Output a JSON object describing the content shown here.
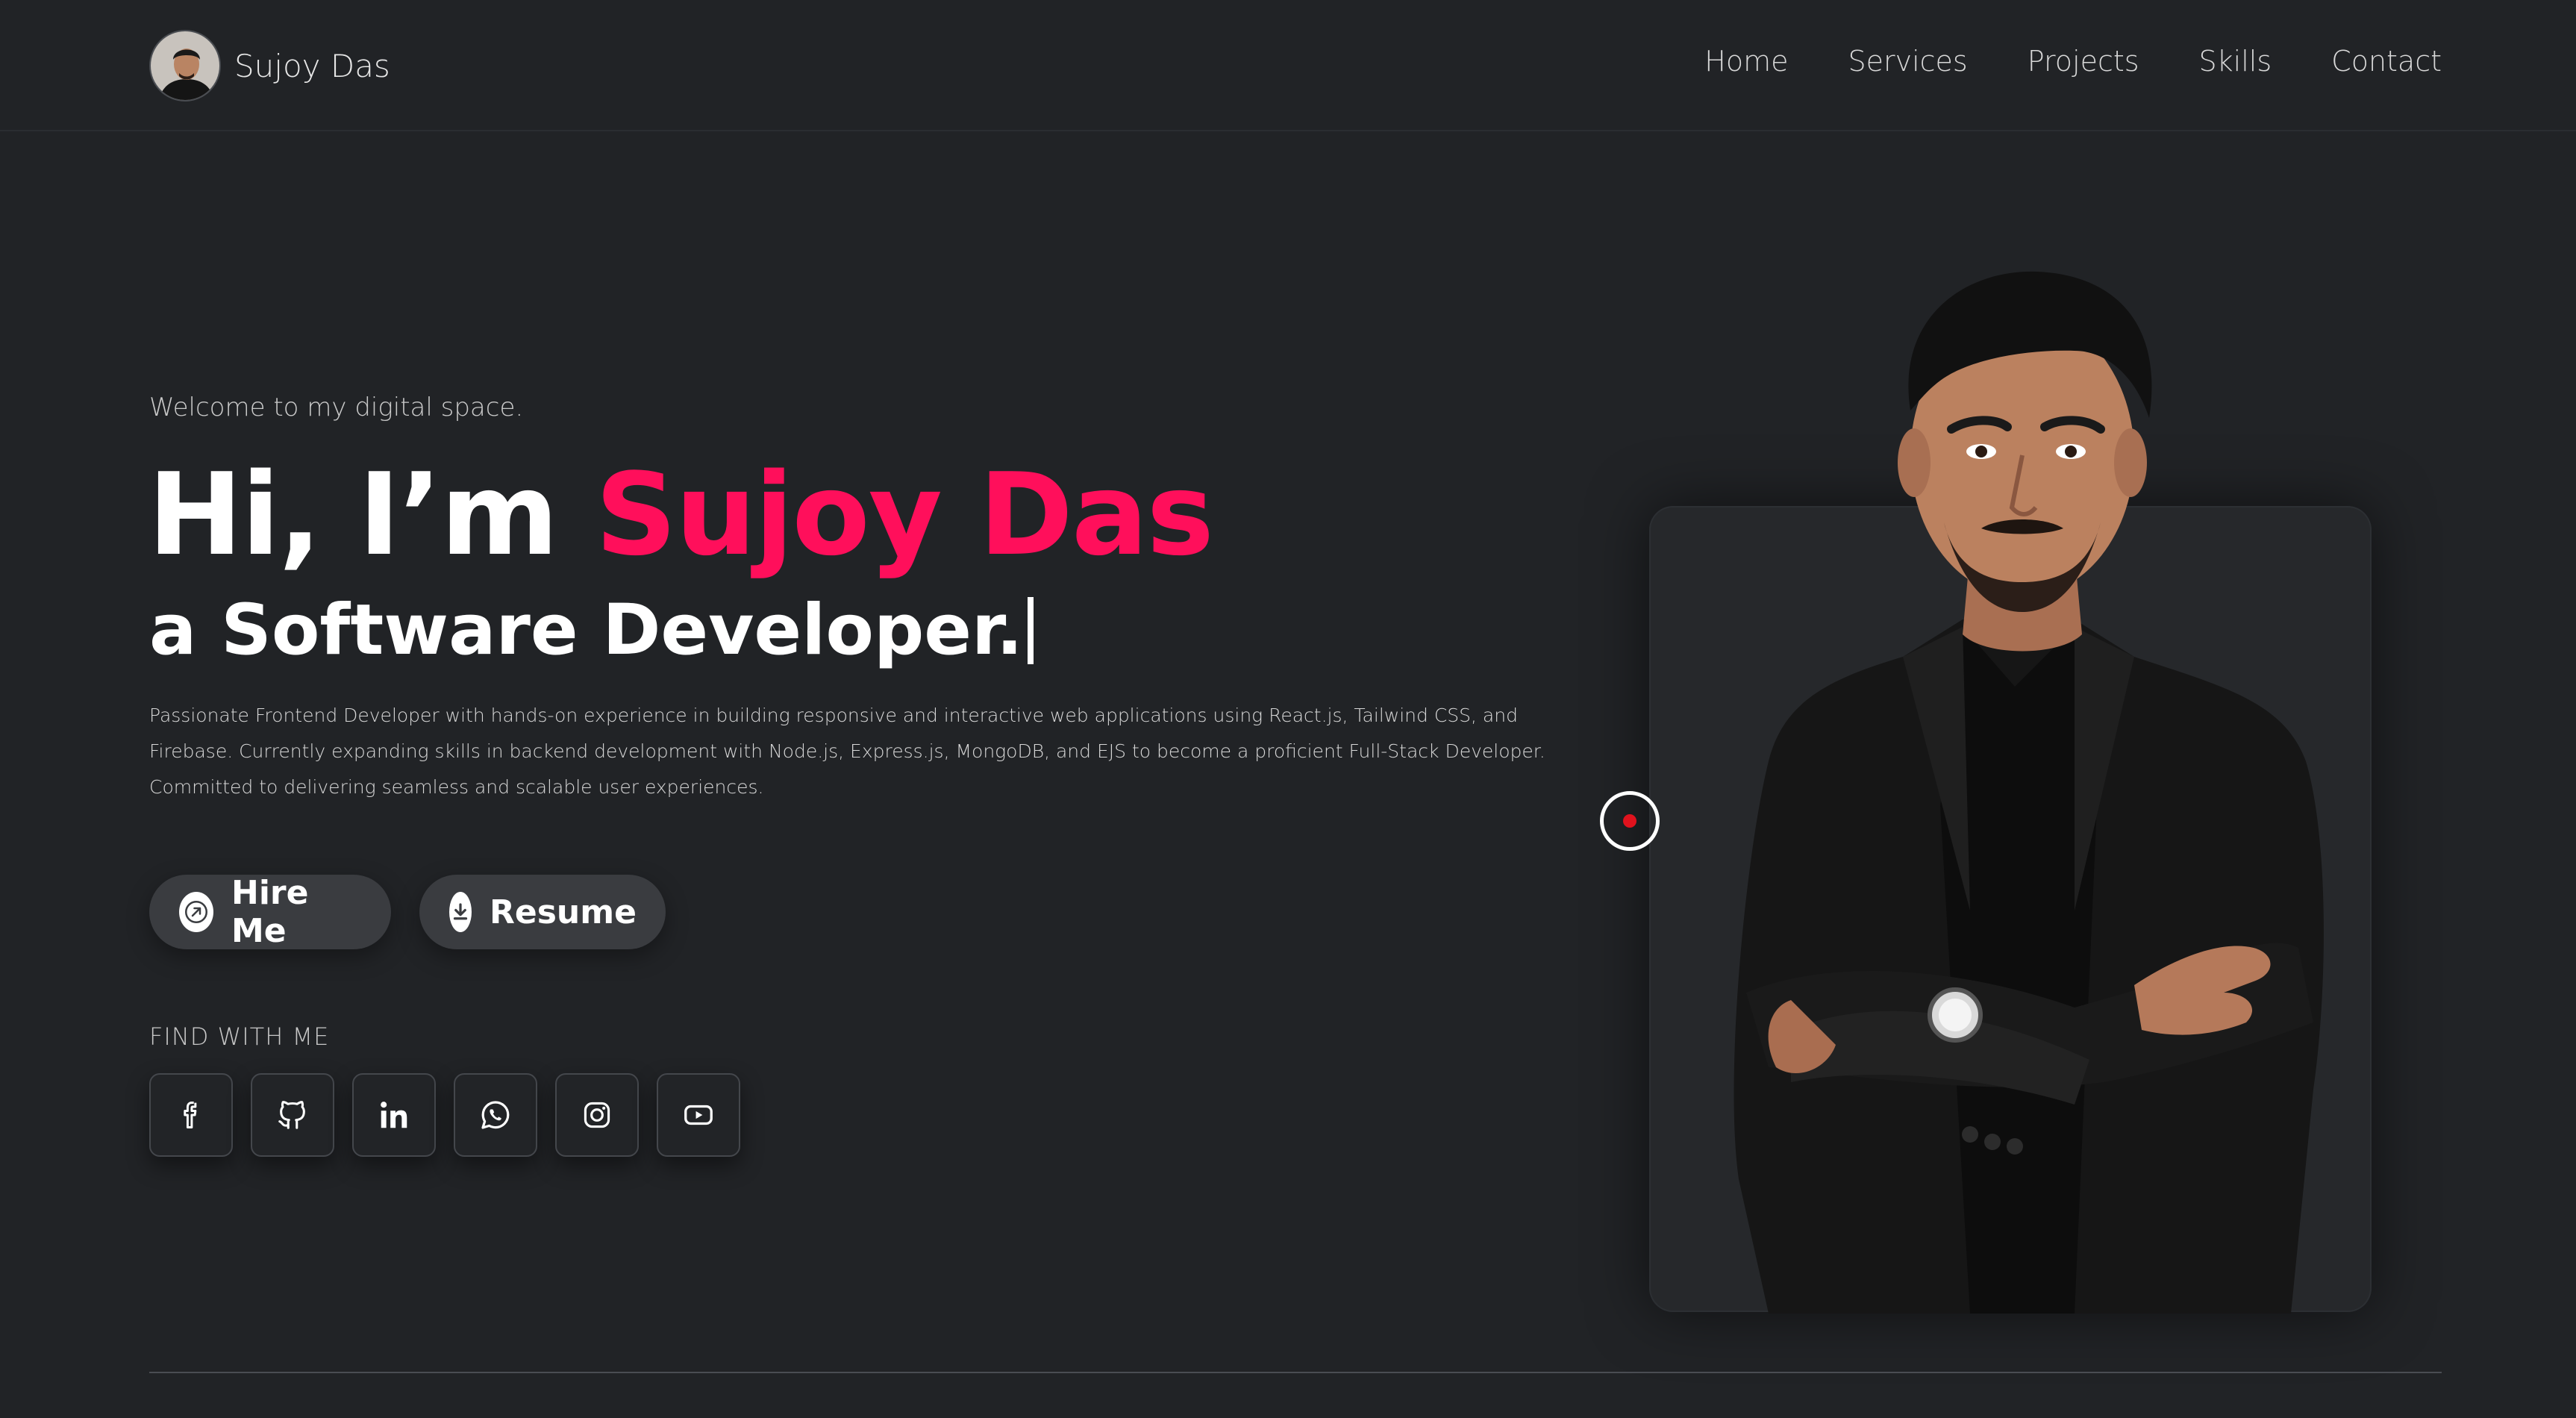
{
  "header": {
    "brand_name": "Sujoy Das",
    "nav": [
      "Home",
      "Services",
      "Projects",
      "Skills",
      "Contact"
    ]
  },
  "hero": {
    "welcome": "Welcome to my digital space.",
    "title_prefix": "Hi, I’m ",
    "title_name": "Sujoy Das",
    "role": "a Software Developer.",
    "bio": "Passionate Frontend Developer with hands-on experience in building responsive and interactive web applications using React.js, Tailwind CSS, and Firebase. Currently expanding skills in backend development with Node.js, Express.js, MongoDB, and EJS to become a proficient Full-Stack Developer. Committed to delivering seamless and scalable user experiences.",
    "buttons": {
      "hire": "Hire Me",
      "resume": "Resume"
    },
    "find_label": "FIND WITH ME",
    "socials": [
      "facebook-icon",
      "github-icon",
      "linkedin-icon",
      "whatsapp-icon",
      "instagram-icon",
      "youtube-icon"
    ]
  },
  "colors": {
    "background": "#212326",
    "accent": "#ff0f5b",
    "button": "#3a3c40"
  }
}
